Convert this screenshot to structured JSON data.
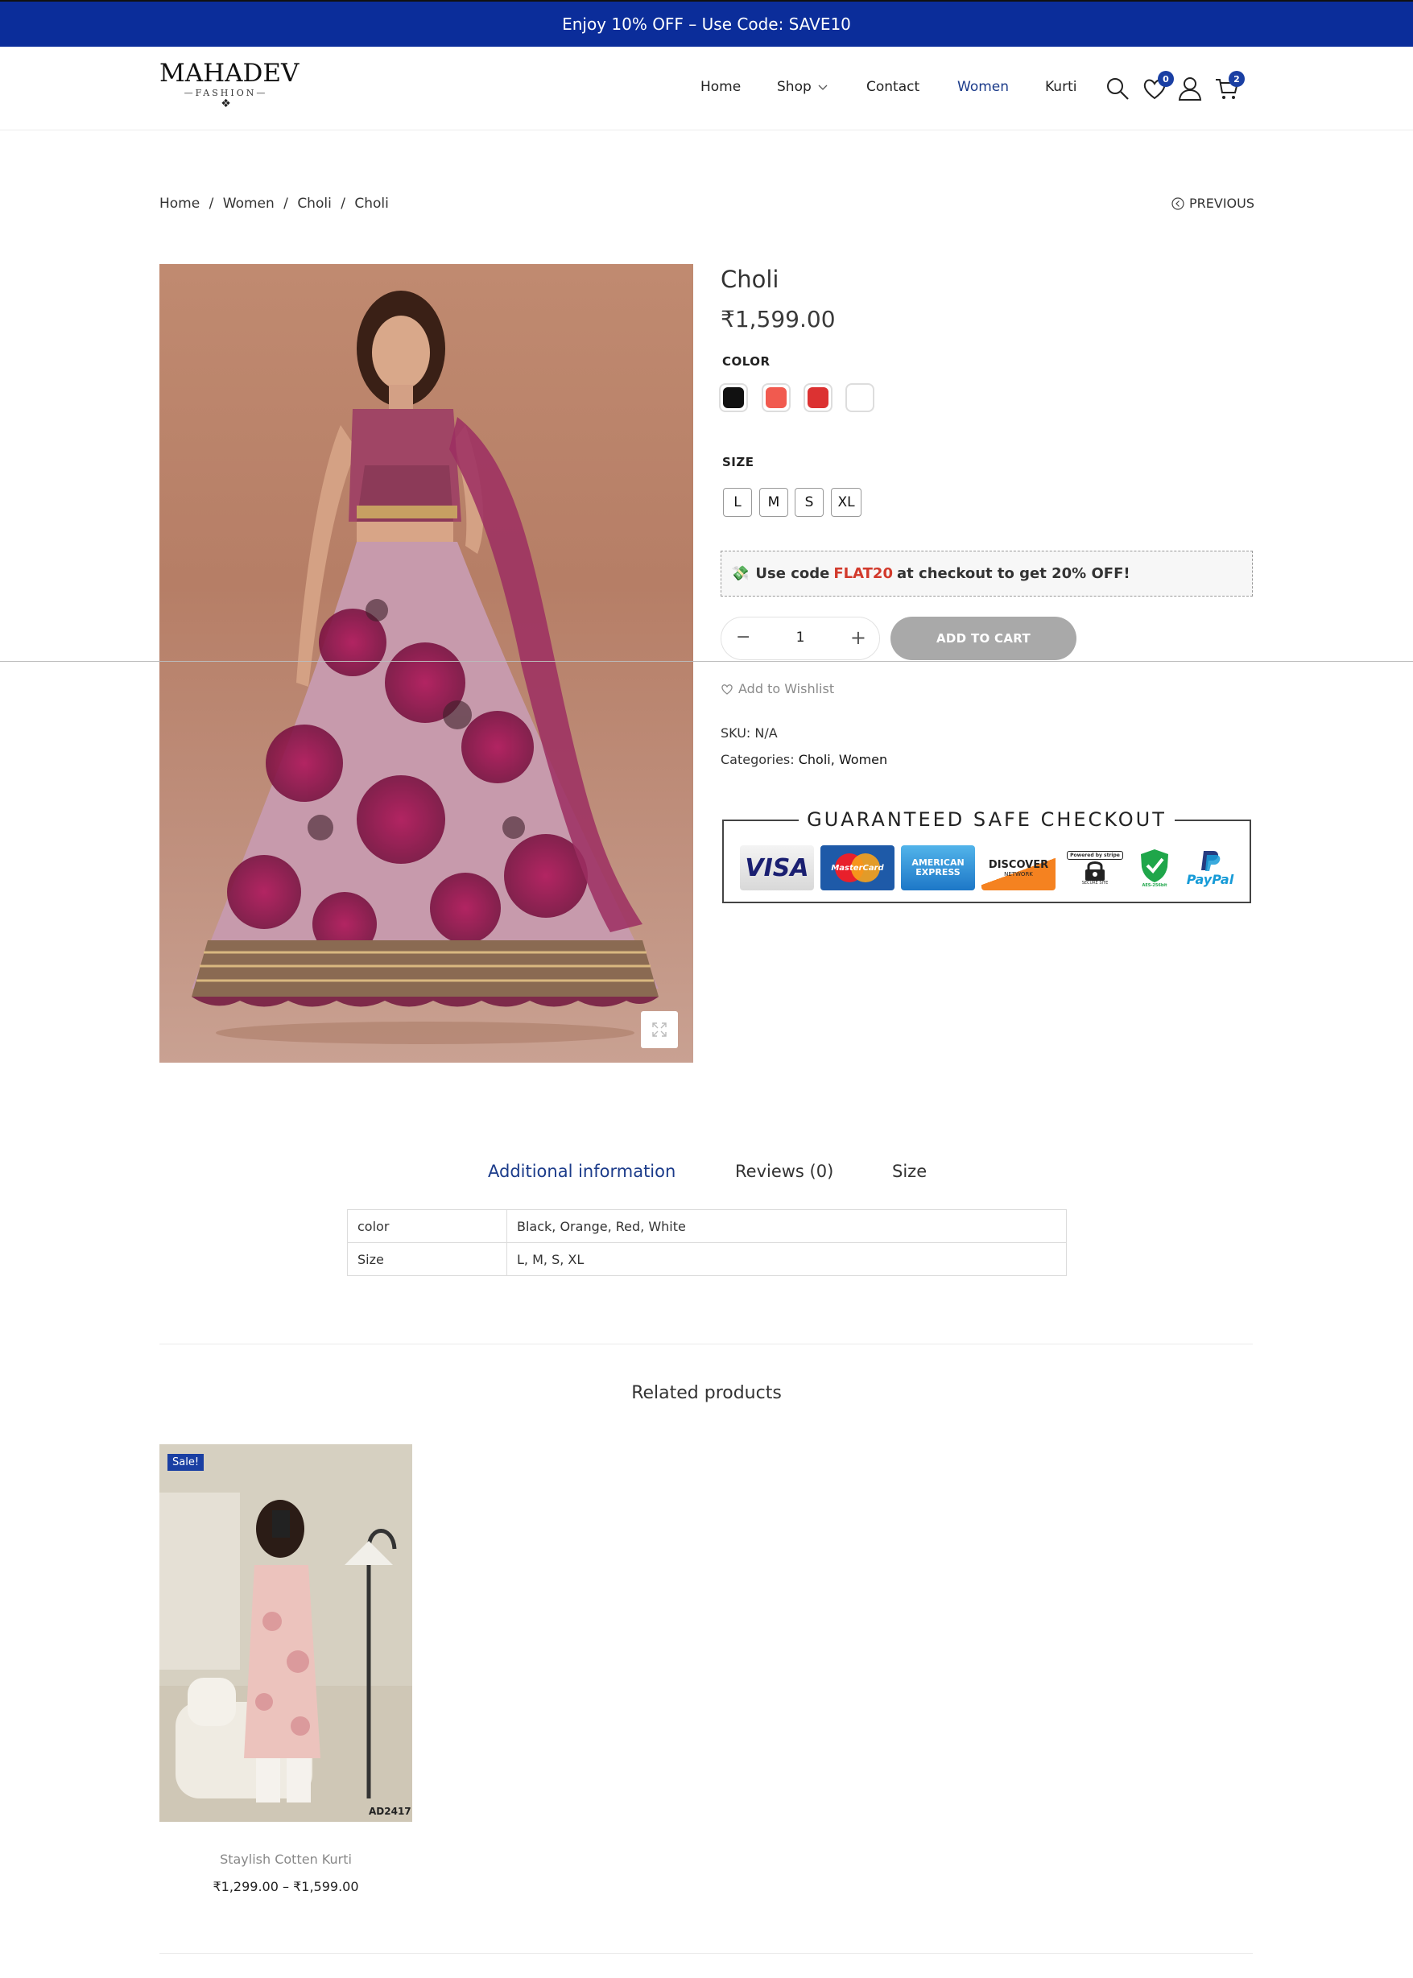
{
  "promo": {
    "text": "Enjoy 10% OFF – Use Code: SAVE10"
  },
  "logo": {
    "name": "MAHADEV",
    "sub": "FASHION",
    "ornament": "❖"
  },
  "nav": {
    "items": [
      {
        "label": "Home"
      },
      {
        "label": "Shop"
      },
      {
        "label": "Contact"
      },
      {
        "label": "Women",
        "active": true
      },
      {
        "label": "Kurti"
      }
    ],
    "wishlist_count": "0",
    "cart_count": "2"
  },
  "breadcrumb": {
    "items": [
      "Home",
      "/",
      "Women",
      "/",
      "Choli",
      "/",
      "Choli"
    ],
    "previous": "PREVIOUS"
  },
  "product": {
    "title": "Choli",
    "price": "₹1,599.00",
    "color_label": "COLOR",
    "colors": [
      "#111111",
      "#f15a4f",
      "#dc3232",
      "#ffffff"
    ],
    "size_label": "SIZE",
    "sizes": [
      "L",
      "M",
      "S",
      "XL"
    ],
    "promo_icon": "💸",
    "promo_prefix": "Use code",
    "promo_code": "FLAT20",
    "promo_suffix": "at checkout to get 20% OFF!",
    "quantity": "1",
    "minus": "−",
    "plus": "+",
    "add_to_cart": "ADD TO CART",
    "wishlist": "Add to Wishlist",
    "sku_label": "SKU:",
    "sku_value": "N/A",
    "categories_label": "Categories:",
    "categories_value": "Choli, Women"
  },
  "safe_checkout": {
    "title": "GUARANTEED SAFE CHECKOUT",
    "cards": {
      "visa": "VISA",
      "mastercard": "MasterCard",
      "amex": "AMERICAN EXPRESS",
      "discover": "DISCOVER",
      "discover_sub": "NETWORK",
      "stripe": "Powered by stripe",
      "stripe_sub": "SECURE SITE",
      "aes": "AES-256bit",
      "paypal": "PayPal"
    }
  },
  "tabs": [
    {
      "label": "Additional information",
      "active": true
    },
    {
      "label": "Reviews (0)"
    },
    {
      "label": "Size"
    }
  ],
  "info_table": [
    {
      "key": "color",
      "value": "Black, Orange, Red, White"
    },
    {
      "key": "Size",
      "value": "L, M, S, XL"
    }
  ],
  "related": {
    "title": "Related products",
    "items": [
      {
        "badge": "Sale!",
        "code": "AD2417",
        "name": "Staylish Cotten Kurti",
        "price": "₹1,299.00 – ₹1,599.00"
      }
    ]
  },
  "colors": {
    "brand_blue": "#0b2d9a",
    "badge_blue": "#1a3fa3",
    "nav_active": "#1b3b8a",
    "promo_code_red": "#d23a2c"
  }
}
